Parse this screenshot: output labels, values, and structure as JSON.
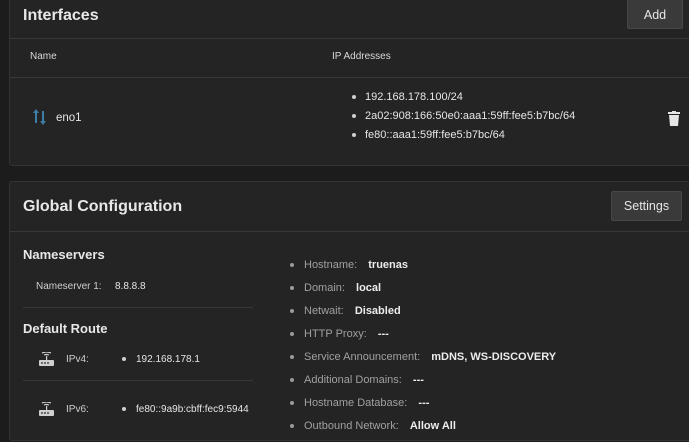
{
  "interfaces": {
    "title": "Interfaces",
    "add_label": "Add",
    "columns": {
      "name": "Name",
      "ip": "IP Addresses"
    },
    "rows": [
      {
        "name": "eno1",
        "ips": [
          "192.168.178.100/24",
          "2a02:908:166:50e0:aaa1:59ff:fee5:b7bc/64",
          "fe80::aaa1:59ff:fee5:b7bc/64"
        ]
      }
    ]
  },
  "global": {
    "title": "Global Configuration",
    "settings_label": "Settings",
    "nameservers": {
      "heading": "Nameservers",
      "items": [
        {
          "label": "Nameserver 1:",
          "value": "8.8.8.8"
        }
      ]
    },
    "default_route": {
      "heading": "Default Route",
      "ipv4": {
        "label": "IPv4:",
        "value": "192.168.178.1"
      },
      "ipv6": {
        "label": "IPv6:",
        "value": "fe80::9a9b:cbff:fec9:5944"
      }
    },
    "config": [
      {
        "label": "Hostname:",
        "value": "truenas"
      },
      {
        "label": "Domain:",
        "value": "local"
      },
      {
        "label": "Netwait:",
        "value": "Disabled"
      },
      {
        "label": "HTTP Proxy:",
        "value": "---"
      },
      {
        "label": "Service Announcement:",
        "value": "mDNS, WS-DISCOVERY"
      },
      {
        "label": "Additional Domains:",
        "value": "---"
      },
      {
        "label": "Hostname Database:",
        "value": "---"
      },
      {
        "label": "Outbound Network:",
        "value": "Allow All"
      }
    ]
  }
}
